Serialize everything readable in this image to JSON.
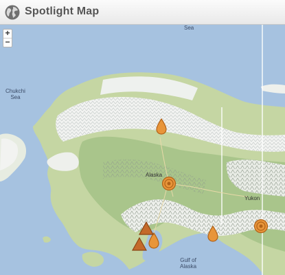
{
  "header": {
    "title": "Spotlight Map",
    "icon": "globe-icon"
  },
  "zoom": {
    "in_label": "+",
    "out_label": "−"
  },
  "map_labels": {
    "sea_top": "Sea",
    "chukchi_line1": "Chukchi",
    "chukchi_line2": "Sea",
    "alaska": "Alaska",
    "yukon": "Yukon",
    "gulf_line1": "Gulf of",
    "gulf_line2": "Alaska"
  },
  "colors": {
    "ocean": "#a6c2e0",
    "land": "#c5d6a3",
    "forest": "#9fbf84",
    "snow": "#f2f3f1",
    "marker_fill": "#e8953a",
    "marker_stroke": "#b06118",
    "triangle_fill": "#c46a2a"
  },
  "markers": [
    {
      "type": "drop",
      "icon": "drop-marker-icon"
    },
    {
      "type": "target",
      "icon": "target-marker-icon"
    },
    {
      "type": "target",
      "icon": "target-marker-icon"
    },
    {
      "type": "drop",
      "icon": "drop-marker-icon"
    },
    {
      "type": "drop",
      "icon": "drop-marker-icon"
    },
    {
      "type": "triangle",
      "icon": "triangle-marker-icon"
    },
    {
      "type": "triangle",
      "icon": "triangle-marker-icon"
    }
  ]
}
